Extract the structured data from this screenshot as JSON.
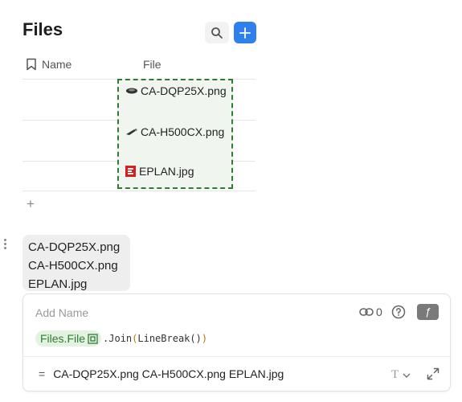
{
  "header": {
    "title": "Files"
  },
  "table": {
    "columns": {
      "name": "Name",
      "file": "File"
    },
    "rows": [
      {
        "name": "",
        "file": "CA-DQP25X.png"
      },
      {
        "name": "",
        "file": "CA-H500CX.png"
      },
      {
        "name": "",
        "file": "EPLAN.jpg"
      }
    ],
    "add_row": "+"
  },
  "result_chip": {
    "lines": [
      "CA-DQP25X.png",
      "CA-H500CX.png",
      "EPLAN.jpg"
    ]
  },
  "editor": {
    "name_placeholder": "Add Name",
    "link_count": "0",
    "fx_label": "ƒ",
    "formula": {
      "reference": "Files.File",
      "method": ".Join",
      "open_paren": "(",
      "arg_fn": "LineBreak",
      "arg_parens": "()",
      "close_paren": ")"
    },
    "result_eq": "=",
    "result_text": "CA-DQP25X.png CA-H500CX.png EPLAN.jpg",
    "type_icon_label": "T"
  },
  "colors": {
    "accent": "#2f80ed",
    "selection_border": "#2e7d32",
    "selection_bg": "#f0f6ef",
    "pill_bg": "#e3f2e1"
  }
}
